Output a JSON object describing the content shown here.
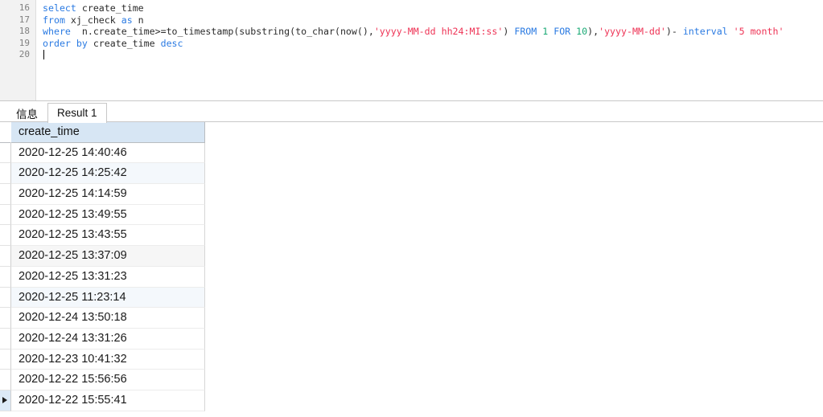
{
  "editor": {
    "line_numbers": [
      "16",
      "17",
      "18",
      "19",
      "20"
    ],
    "lines": [
      {
        "number": "16",
        "tokens": [
          {
            "t": "select",
            "c": "kw"
          },
          {
            "t": " create_time",
            "c": "plain"
          }
        ]
      },
      {
        "number": "17",
        "tokens": [
          {
            "t": "from",
            "c": "kw"
          },
          {
            "t": " xj_check ",
            "c": "plain"
          },
          {
            "t": "as",
            "c": "kw"
          },
          {
            "t": " n",
            "c": "plain"
          }
        ]
      },
      {
        "number": "18",
        "tokens": [
          {
            "t": "where",
            "c": "kw"
          },
          {
            "t": "  n.create_time>=to_timestamp(substring(to_char(now(),",
            "c": "plain"
          },
          {
            "t": "'yyyy-MM-dd hh24:MI:ss'",
            "c": "str"
          },
          {
            "t": ") ",
            "c": "plain"
          },
          {
            "t": "FROM",
            "c": "kw"
          },
          {
            "t": " ",
            "c": "plain"
          },
          {
            "t": "1",
            "c": "num"
          },
          {
            "t": " ",
            "c": "plain"
          },
          {
            "t": "FOR",
            "c": "kw"
          },
          {
            "t": " ",
            "c": "plain"
          },
          {
            "t": "10",
            "c": "num"
          },
          {
            "t": "),",
            "c": "plain"
          },
          {
            "t": "'yyyy-MM-dd'",
            "c": "str"
          },
          {
            "t": ")- ",
            "c": "plain"
          },
          {
            "t": "interval",
            "c": "kw"
          },
          {
            "t": " ",
            "c": "plain"
          },
          {
            "t": "'5 month'",
            "c": "str"
          }
        ]
      },
      {
        "number": "19",
        "tokens": [
          {
            "t": "order by",
            "c": "kw"
          },
          {
            "t": " create_time ",
            "c": "plain"
          },
          {
            "t": "desc",
            "c": "kw"
          }
        ]
      },
      {
        "number": "20",
        "tokens": [],
        "caret": true
      }
    ],
    "full_sql": "select create_time\nfrom xj_check as n\nwhere  n.create_time>=to_timestamp(substring(to_char(now(),'yyyy-MM-dd hh24:MI:ss') FROM 1 FOR 10),'yyyy-MM-dd')- interval '5 month'\norder by create_time desc"
  },
  "tabs": [
    {
      "label": "信息",
      "active": false
    },
    {
      "label": "Result 1",
      "active": true
    }
  ],
  "grid": {
    "columns": [
      "create_time"
    ],
    "rows": [
      [
        "2020-12-25 14:40:46"
      ],
      [
        "2020-12-25 14:25:42"
      ],
      [
        "2020-12-25 14:14:59"
      ],
      [
        "2020-12-25 13:49:55"
      ],
      [
        "2020-12-25 13:43:55"
      ],
      [
        "2020-12-25 13:37:09"
      ],
      [
        "2020-12-25 13:31:23"
      ],
      [
        "2020-12-25 11:23:14"
      ],
      [
        "2020-12-24 13:50:18"
      ],
      [
        "2020-12-24 13:31:26"
      ],
      [
        "2020-12-23 10:41:32"
      ],
      [
        "2020-12-22 15:56:56"
      ],
      [
        "2020-12-22 15:55:41"
      ]
    ],
    "current_row_index": 12,
    "row_marker_icon": "triangle-right-icon"
  },
  "colors": {
    "keyword": "#2a7ae2",
    "string": "#ee3355",
    "number": "#19a974",
    "header_bg": "#d7e6f4",
    "gutter_bg": "#f2f2f2",
    "row_alt_bg": "#f4f8fc"
  }
}
